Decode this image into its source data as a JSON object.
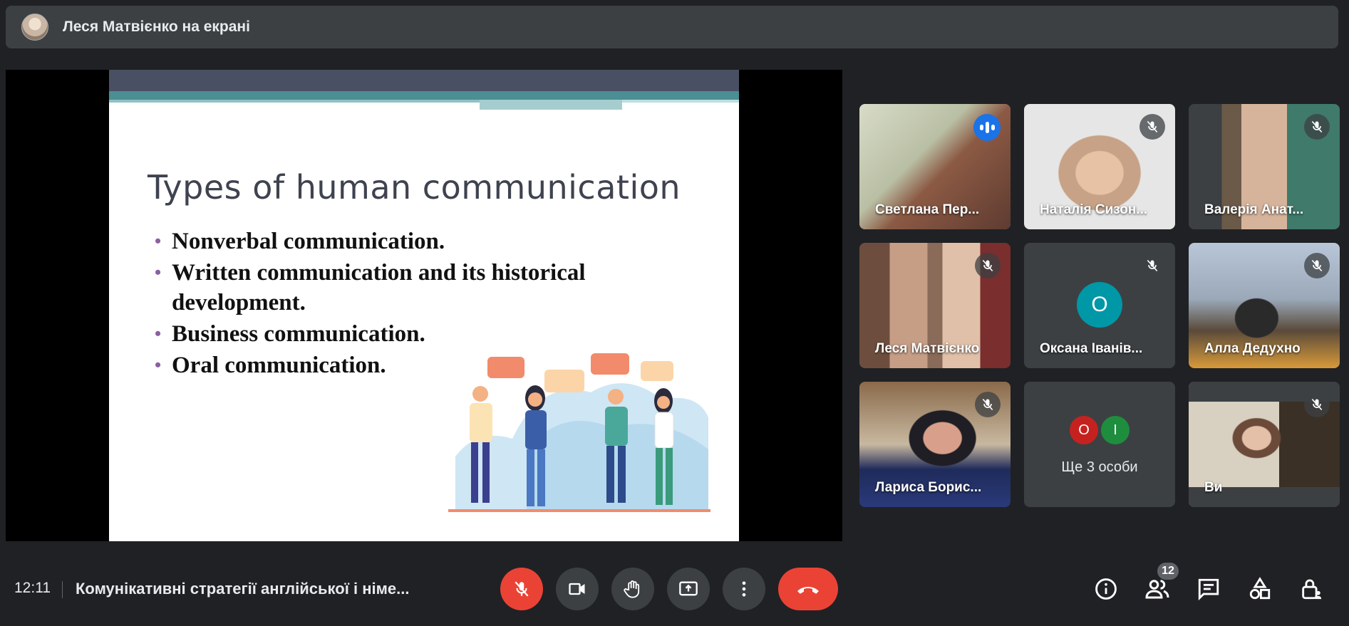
{
  "header": {
    "presenter_text": "Леся Матвієнко на екрані"
  },
  "slide": {
    "title": "Types of human communication",
    "bullets": [
      "Nonverbal communication.",
      "Written communication and its historical development.",
      "Business communication.",
      "Oral communication."
    ]
  },
  "participants": [
    {
      "name": "Светлана Пер...",
      "speaking": true
    },
    {
      "name": "Наталія Сизон...",
      "muted": true
    },
    {
      "name": "Валерія Анат...",
      "muted": true
    },
    {
      "name": "Леся Матвієнко",
      "muted": true
    },
    {
      "name": "Оксана Іванів...",
      "initial": "О",
      "muted": true
    },
    {
      "name": "Алла Дедухно",
      "muted": true
    },
    {
      "name": "Лариса Борис...",
      "muted": true
    },
    {
      "name": "Ще 3 особи",
      "initials": [
        "О",
        "І"
      ]
    },
    {
      "name": "Ви",
      "muted": true
    }
  ],
  "footer": {
    "time": "12:11",
    "meeting_title": "Комунікативні стратегії англійської і німе...",
    "people_count": "12"
  },
  "colors": {
    "accent": "#8ab4f8",
    "danger": "#ea4335",
    "speaking": "#1a73e8"
  }
}
